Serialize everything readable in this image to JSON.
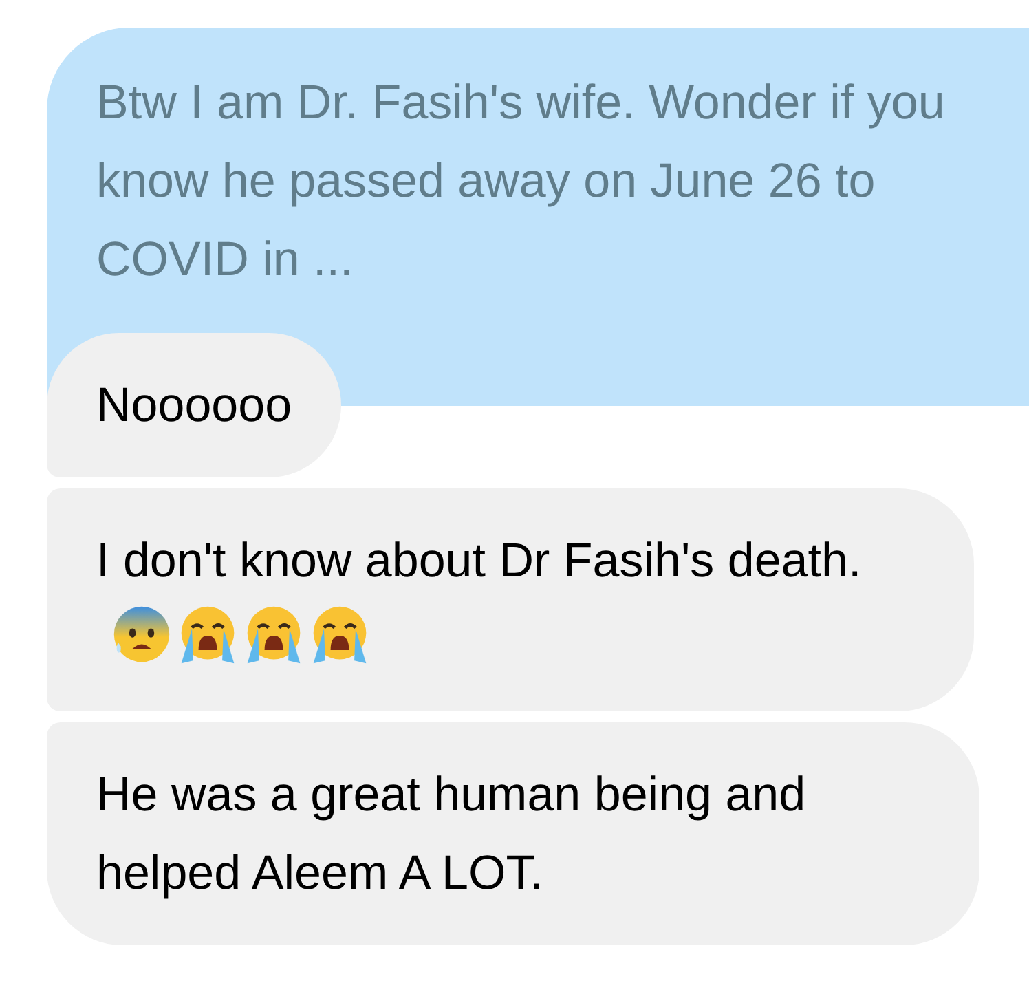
{
  "messages": [
    {
      "kind": "sent",
      "text": "Btw I am Dr. Fasih's wife. Wonder if you know he passed away on June 26 to COVID in ..."
    },
    {
      "kind": "received",
      "text": "Noooooo"
    },
    {
      "kind": "received",
      "text": "I don't know about Dr Fasih's death.",
      "emoji": [
        {
          "kind": "anxious"
        },
        {
          "kind": "crying"
        },
        {
          "kind": "crying"
        },
        {
          "kind": "crying"
        }
      ]
    },
    {
      "kind": "received",
      "text": "He was a great human being and helped Aleem A LOT."
    }
  ]
}
